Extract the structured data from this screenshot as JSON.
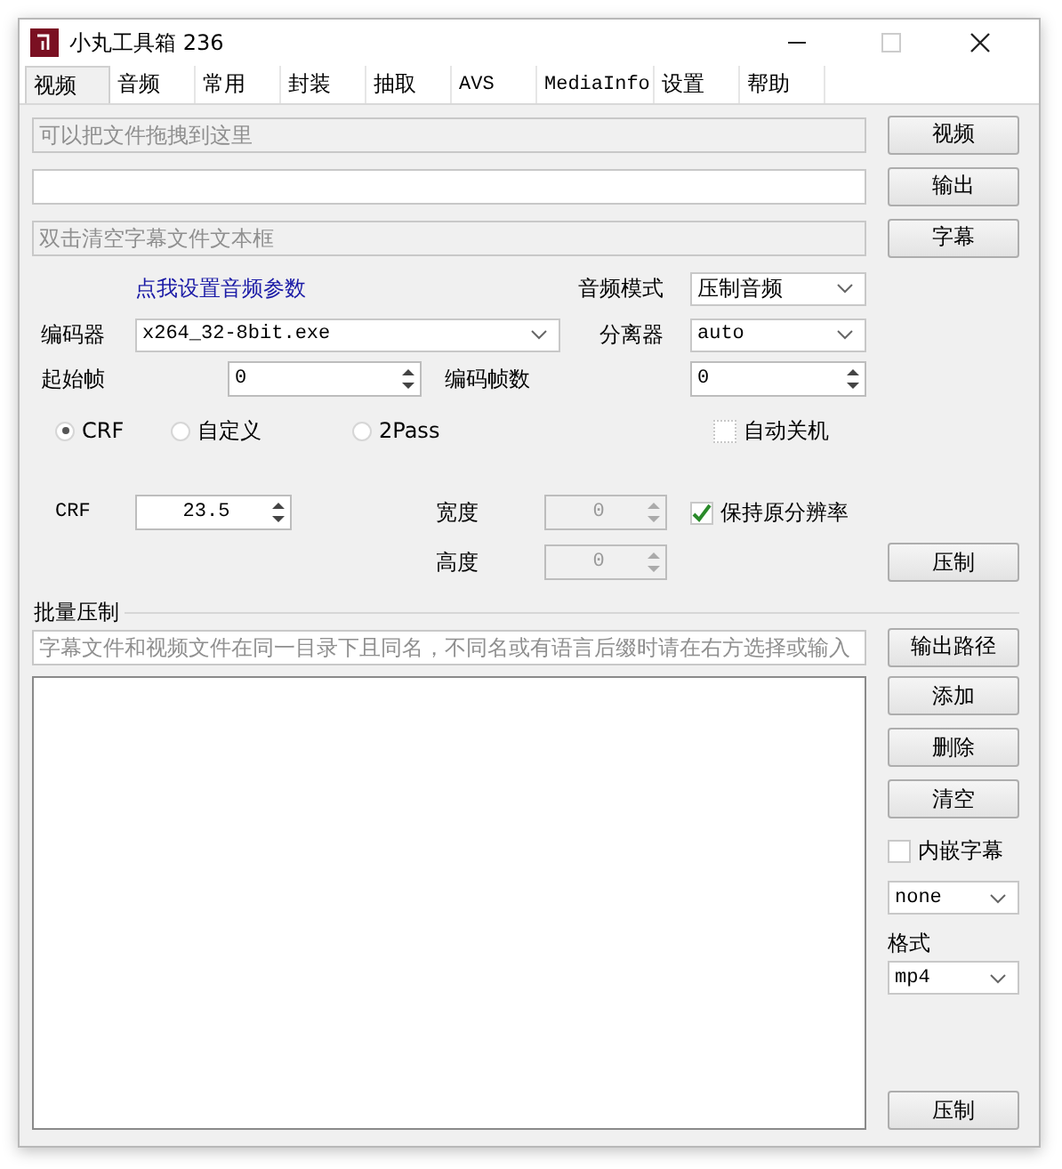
{
  "window": {
    "title": "小丸工具箱 236"
  },
  "tabs": [
    {
      "label": "视频",
      "selected": true
    },
    {
      "label": "音频",
      "selected": false
    },
    {
      "label": "常用",
      "selected": false
    },
    {
      "label": "封装",
      "selected": false
    },
    {
      "label": "抽取",
      "selected": false
    },
    {
      "label": "AVS",
      "selected": false
    },
    {
      "label": "MediaInfo",
      "selected": false
    },
    {
      "label": "设置",
      "selected": false
    },
    {
      "label": "帮助",
      "selected": false
    }
  ],
  "file_rows": [
    {
      "placeholder": "可以把文件拖拽到这里",
      "button": "视频"
    },
    {
      "button": "输出"
    },
    {
      "placeholder": "双击清空字幕文件文本框",
      "button": "字幕"
    }
  ],
  "audio_link": "点我设置音频参数",
  "audio_mode": {
    "label": "音频模式",
    "value": "压制音频"
  },
  "encoder": {
    "label": "编码器",
    "value": "x264_32-8bit.exe"
  },
  "demuxer": {
    "label": "分离器",
    "value": "auto"
  },
  "start_frame": {
    "label": "起始帧",
    "value": "0"
  },
  "frame_count": {
    "label": "编码帧数",
    "value": "0"
  },
  "modes": [
    {
      "label": "CRF",
      "selected": true
    },
    {
      "label": "自定义",
      "selected": false
    },
    {
      "label": "2Pass",
      "selected": false
    }
  ],
  "auto_shutdown": {
    "label": "自动关机",
    "checked": false
  },
  "crf": {
    "label": "CRF",
    "value": "23.5"
  },
  "width": {
    "label": "宽度",
    "value": "0",
    "disabled": true
  },
  "height": {
    "label": "高度",
    "value": "0",
    "disabled": true
  },
  "keep_resolution": {
    "label": "保持原分辨率",
    "checked": true
  },
  "encode_button": "压制",
  "batch": {
    "title": "批量压制",
    "placeholder": "字幕文件和视频文件在同一目录下且同名，不同名或有语言后缀时请在右方选择或输入",
    "output_button": "输出路径",
    "buttons": [
      "添加",
      "删除",
      "清空"
    ],
    "embed_subtitles": {
      "label": "内嵌字幕",
      "checked": false
    },
    "subtitle_option": "none",
    "format_label": "格式",
    "format": "mp4",
    "encode_button": "压制"
  }
}
